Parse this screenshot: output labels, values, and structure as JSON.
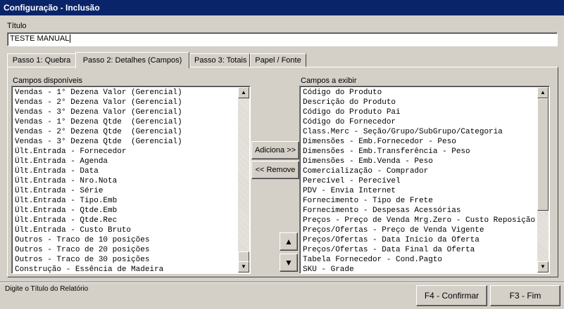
{
  "window": {
    "title": "Configuração - Inclusão"
  },
  "titulo": {
    "label": "Título",
    "value": "TESTE MANUAL"
  },
  "tabs": [
    {
      "label": "Passo 1: Quebra"
    },
    {
      "label": "Passo 2: Detalhes (Campos)"
    },
    {
      "label": "Passo 3: Totais"
    },
    {
      "label": "Papel / Fonte"
    }
  ],
  "available": {
    "label": "Campos disponíveis",
    "items": [
      "Vendas - 1° Dezena Valor (Gerencial)",
      "Vendas - 2° Dezena Valor (Gerencial)",
      "Vendas - 3° Dezena Valor (Gerencial)",
      "Vendas - 1° Dezena Qtde  (Gerencial)",
      "Vendas - 2° Dezena Qtde  (Gerencial)",
      "Vendas - 3° Dezena Qtde  (Gerencial)",
      "Últ.Entrada - Fornecedor",
      "Últ.Entrada - Agenda",
      "Últ.Entrada - Data",
      "Últ.Entrada - Nro.Nota",
      "Últ.Entrada - Série",
      "Últ.Entrada - Tipo.Emb",
      "Últ.Entrada - Qtde.Emb",
      "Últ.Entrada - Qtde.Rec",
      "Últ.Entrada - Custo Bruto",
      "Outros - Traco de 10 posições",
      "Outros - Traco de 20 posições",
      "Outros - Traco de 30 posições",
      "Construção - Essência de Madeira"
    ]
  },
  "selected": {
    "label": "Campos a exibir",
    "items": [
      "Código do Produto",
      "Descrição do Produto",
      "Código do Produto Pai",
      "Código do Fornecedor",
      "Class.Merc - Seção/Grupo/SubGrupo/Categoria",
      "Dimensões - Emb.Fornecedor - Peso",
      "Dimensões - Emb.Transferência - Peso",
      "Dimensões - Emb.Venda - Peso",
      "Comercialização - Comprador",
      "Perecível - Perecível",
      "PDV - Envia Internet",
      "Fornecimento - Tipo de Frete",
      "Fornecimento - Despesas Acessórias",
      "Preços - Preço de Venda Mrg.Zero - Custo Reposição",
      "Preços/Ofertas - Preço de Venda Vigente",
      "Preços/Ofertas - Data Início da Oferta",
      "Preços/Ofertas - Data Final da Oferta",
      "Tabela Fornecedor - Cond.Pagto",
      "SKU - Grade"
    ]
  },
  "buttons": {
    "add": "Adiciona >>",
    "remove": "<< Remove",
    "up": "▲",
    "down": "▼",
    "confirm": "F4 - Confirmar",
    "end": "F3 - Fim"
  },
  "status": {
    "hint": "Digite o Título do Relatório"
  }
}
